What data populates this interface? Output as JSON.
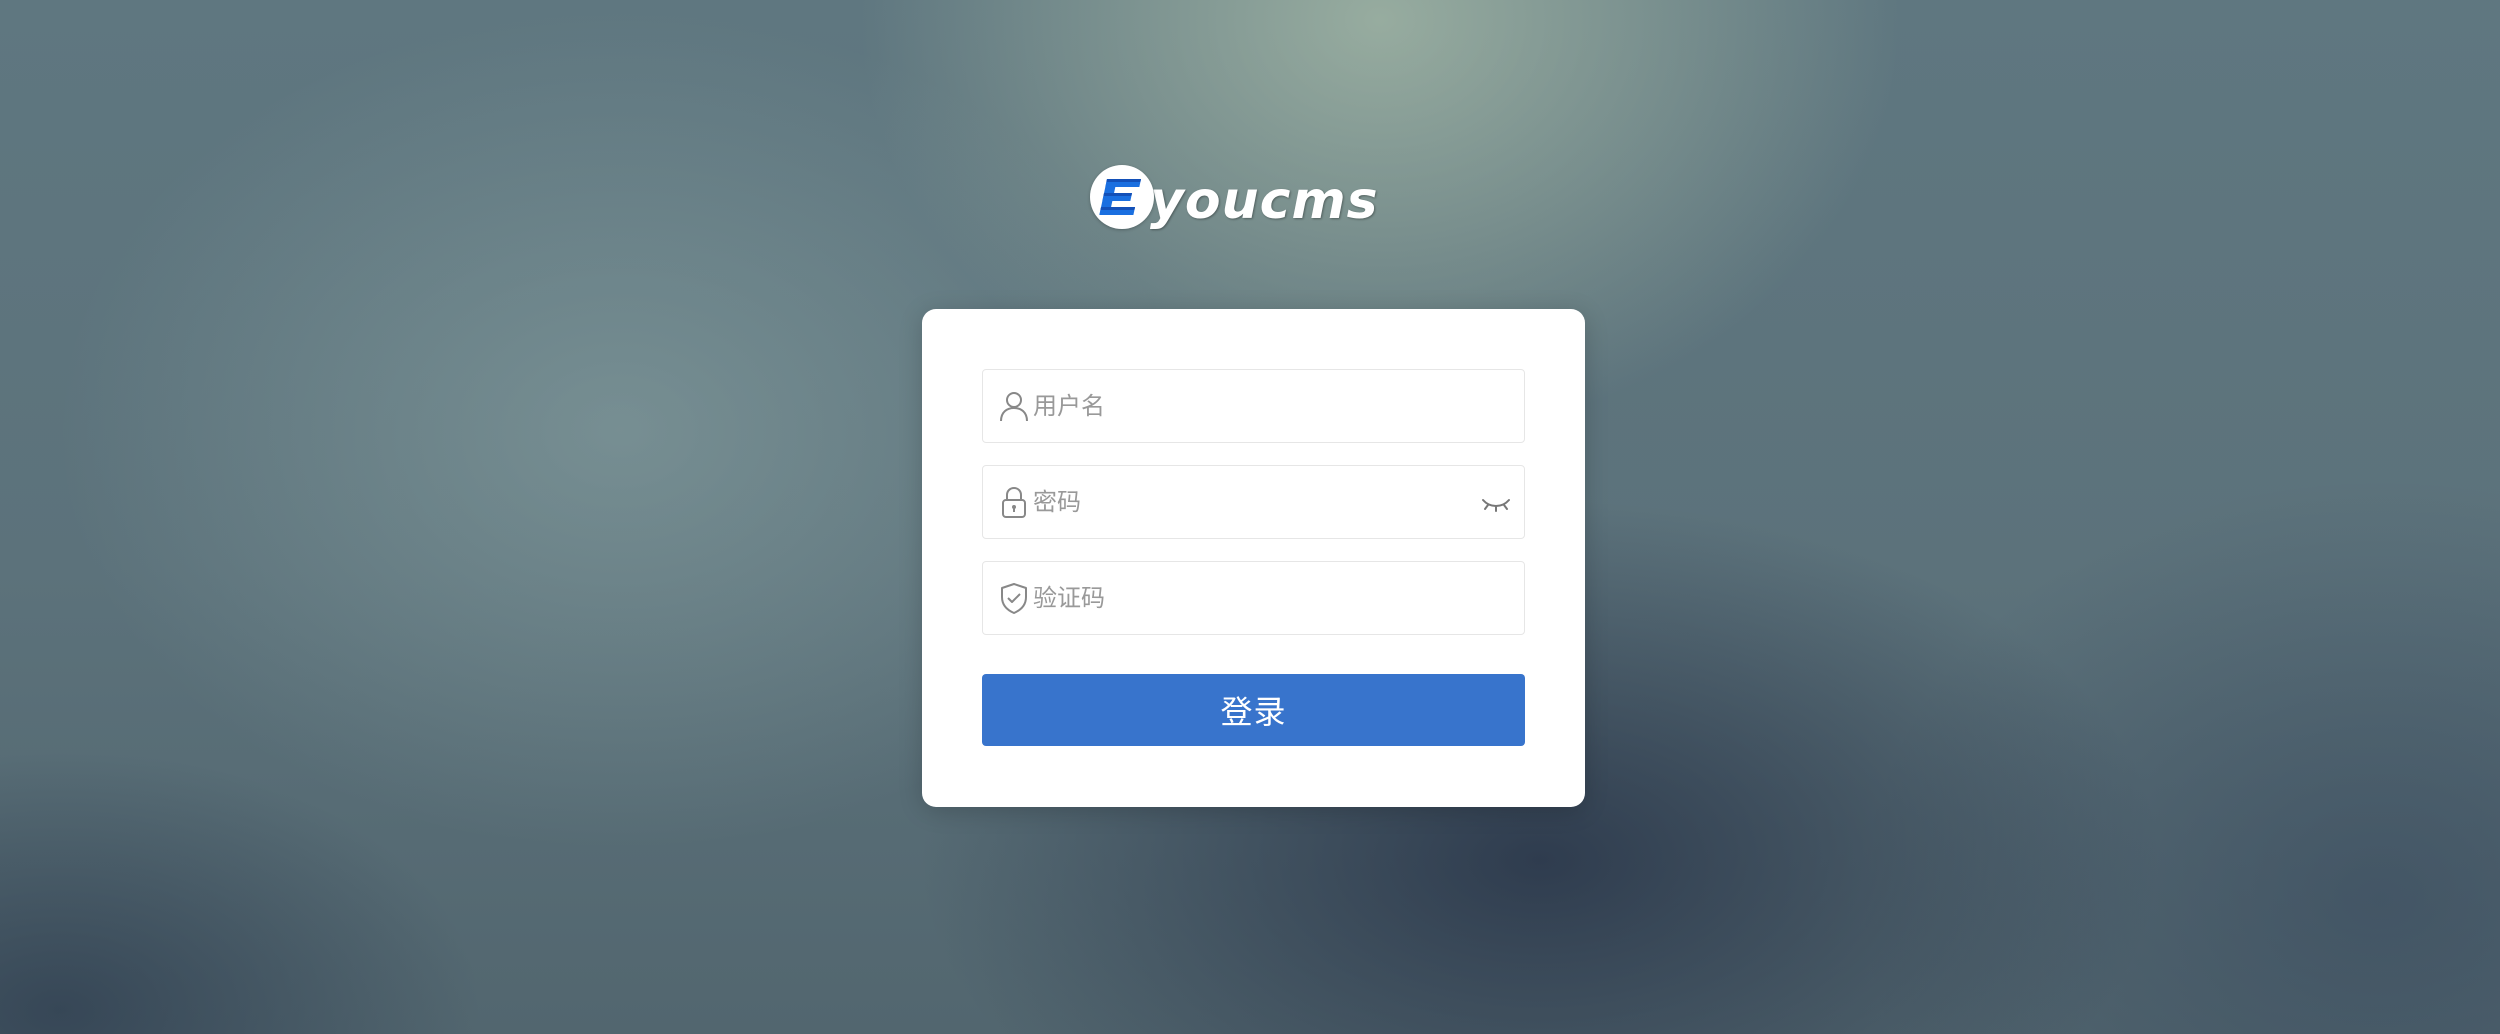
{
  "logo": {
    "mark_letter": "E",
    "text": "youcms",
    "icon": "eyoucms-logo-icon"
  },
  "form": {
    "username": {
      "placeholder": "用户名",
      "value": "",
      "icon": "user-icon"
    },
    "password": {
      "placeholder": "密码",
      "value": "",
      "icon": "lock-icon",
      "toggle_icon": "eye-closed-icon"
    },
    "captcha": {
      "placeholder": "验证码",
      "value": "",
      "icon": "shield-check-icon"
    },
    "submit_label": "登录"
  },
  "colors": {
    "primary_button": "#3874cc",
    "placeholder_text": "#999999",
    "field_border": "#e6e6e6",
    "logo_blue": "#1a6fe0"
  }
}
